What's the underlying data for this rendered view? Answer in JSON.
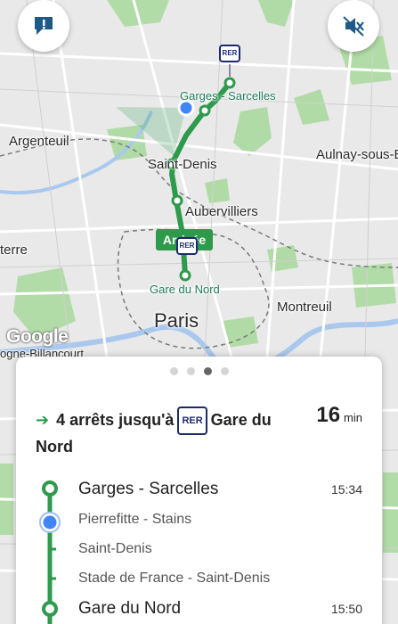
{
  "map": {
    "places": {
      "argenteuil": "Argenteuil",
      "aulnay": "Aulnay-sous-B",
      "saint_denis": "Saint-Denis",
      "aubervilliers": "Aubervilliers",
      "terre": "terre",
      "montreuil": "Montreuil",
      "paris": "Paris",
      "billancourt": "ogne-Billancourt"
    },
    "stations": {
      "garges": "Garges - Sarcelles",
      "gare_du_nord": "Gare du Nord"
    },
    "arrivee_label": "Arrivée",
    "rer_badge": "RER",
    "google_logo": "Google",
    "route_color": "#2e9a4c"
  },
  "buttons": {
    "report_icon": "report-icon",
    "mute_icon": "speaker-muted-icon"
  },
  "sheet": {
    "page_dots": 4,
    "active_dot": 3,
    "summary": {
      "prefix": "4 arrêts jusqu'à",
      "line_badge": "RER",
      "destination": "Gare du Nord"
    },
    "duration": {
      "value": "16",
      "unit": "min"
    },
    "stops": [
      {
        "name": "Garges - Sarcelles",
        "time": "15:34",
        "type": "major"
      },
      {
        "name": "Pierrefitte - Stains",
        "time": "",
        "type": "minor"
      },
      {
        "name": "Saint-Denis",
        "time": "",
        "type": "minor"
      },
      {
        "name": "Stade de France - Saint-Denis",
        "time": "",
        "type": "minor"
      },
      {
        "name": "Gare du Nord",
        "time": "15:50",
        "type": "major"
      }
    ]
  }
}
